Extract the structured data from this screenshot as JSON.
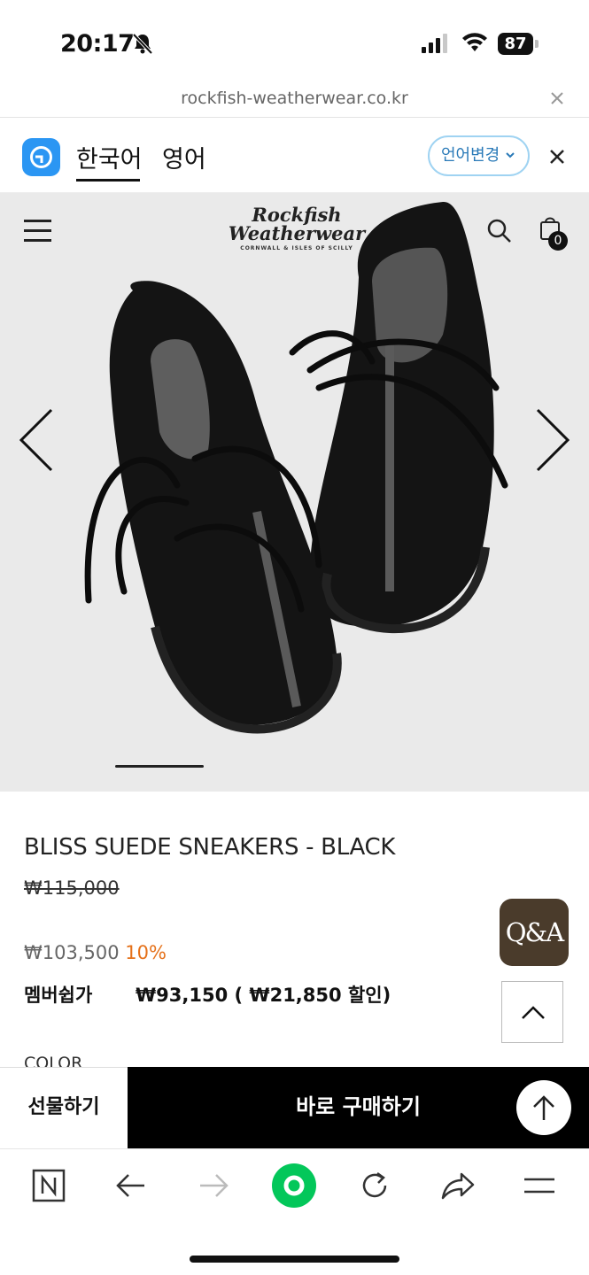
{
  "status_bar": {
    "time": "20:17",
    "battery": "87"
  },
  "browser": {
    "url": "rockfish-weatherwear.co.kr"
  },
  "translate_bar": {
    "tabs": [
      "한국어",
      "영어"
    ],
    "language_button": "언어변경"
  },
  "site_header": {
    "brand_line1": "Rockfish",
    "brand_line2": "Weatherwear",
    "brand_tagline": "CORNWALL & ISLES OF SCILLY",
    "cart_count": "0"
  },
  "product": {
    "name": "BLISS SUEDE SNEAKERS - BLACK",
    "original_price": "₩115,000",
    "sale_price": "₩103,500",
    "discount": "10%",
    "member_label": "멤버쉽가",
    "member_price": "₩93,150 ( ₩21,850 할인)",
    "color_label": "COLOR"
  },
  "floating": {
    "qa_label": "Q&A"
  },
  "actions": {
    "gift_label": "선물하기",
    "buy_label": "바로 구매하기"
  },
  "colors": {
    "accent_discount": "#e5711a",
    "buy_bg": "#000000",
    "qa_bg": "#4a3b2b",
    "translate_logo": "#2b96f3",
    "naver_green": "#03c75a"
  }
}
